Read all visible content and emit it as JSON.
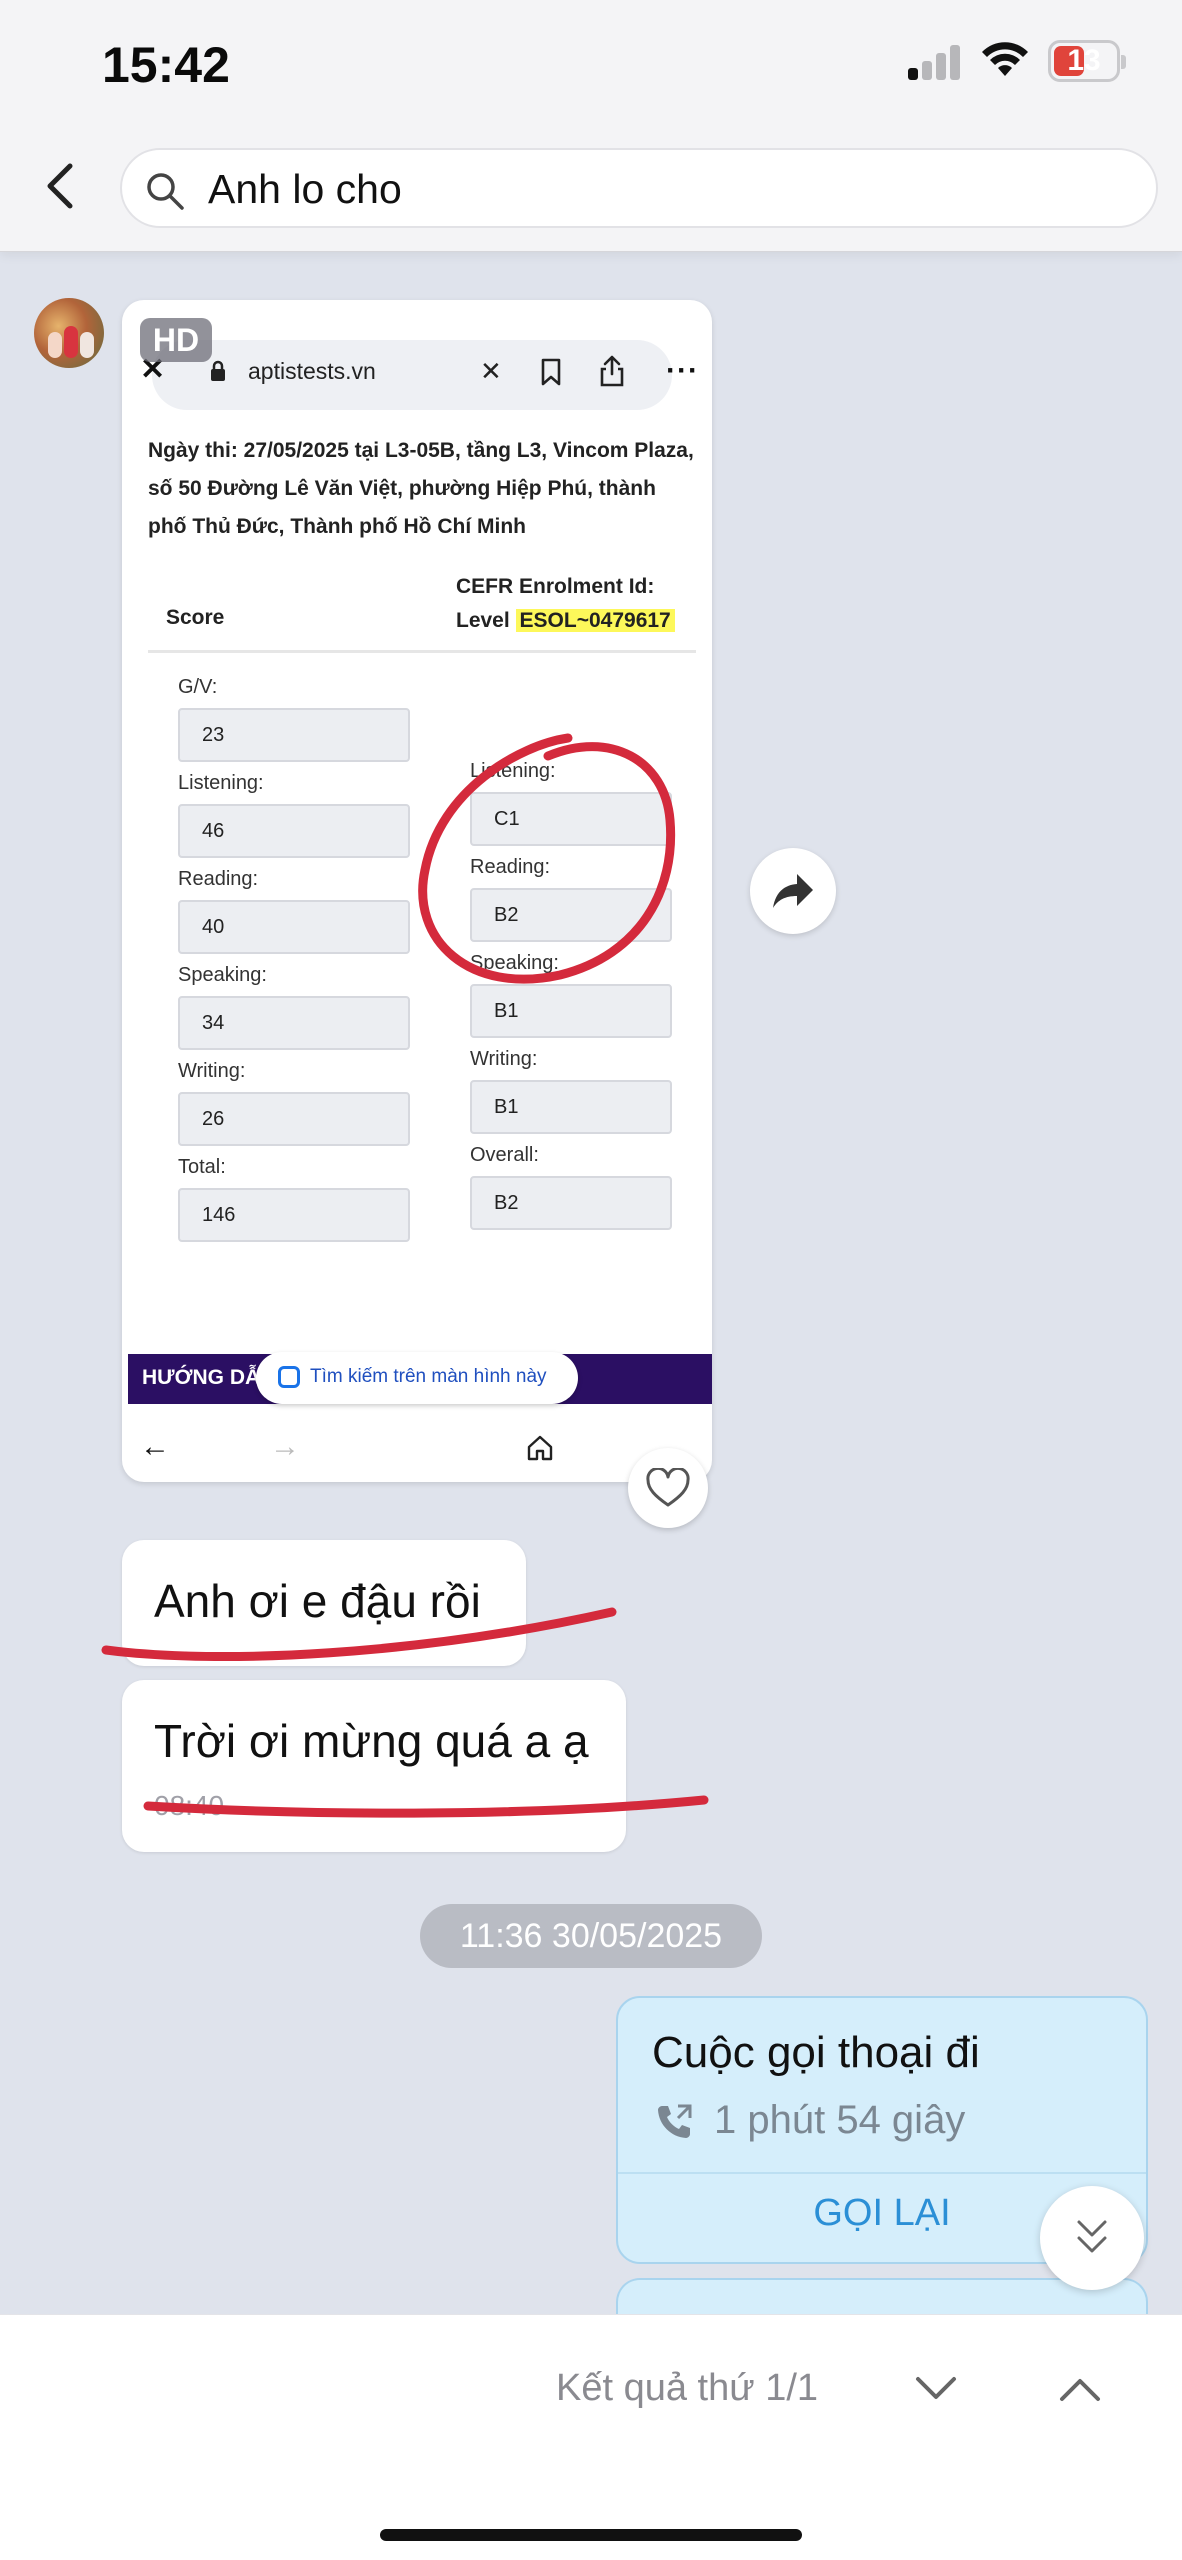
{
  "status_bar": {
    "time": "15:42",
    "battery": "13"
  },
  "header": {
    "search_value": "Anh lo cho"
  },
  "inner_screenshot": {
    "url": "aptistests.vn",
    "exam_info": "Ngày thi: 27/05/2025 tại L3-05B, tầng L3, Vincom Plaza, số 50 Đường Lê Văn Việt, phường Hiệp Phú, thành phố Thủ Đức, Thành phố Hồ Chí Minh",
    "score_header": "Score",
    "cefr_header_1": "CEFR",
    "cefr_header_2": "Level",
    "enrolment_label": "Enrolment Id:",
    "enrolment_id": "ESOL~0479617",
    "scores": [
      {
        "label": "G/V:",
        "value": "23"
      },
      {
        "label": "Listening:",
        "value": "46"
      },
      {
        "label": "Reading:",
        "value": "40"
      },
      {
        "label": "Speaking:",
        "value": "34"
      },
      {
        "label": "Writing:",
        "value": "26"
      },
      {
        "label": "Total:",
        "value": "146"
      }
    ],
    "levels": [
      {
        "label": "Listening:",
        "value": "C1"
      },
      {
        "label": "Reading:",
        "value": "B2"
      },
      {
        "label": "Speaking:",
        "value": "B1"
      },
      {
        "label": "Writing:",
        "value": "B1"
      },
      {
        "label": "Overall:",
        "value": "B2"
      }
    ],
    "banner_text": "HƯỚNG DẪ",
    "lens_chip": "Tìm kiếm trên màn hình này"
  },
  "image_badge": "HD",
  "messages": [
    {
      "text": "Anh ơi e đậu rồi"
    },
    {
      "text": "Trời ơi mừng quá a ạ",
      "time": "08:40"
    }
  ],
  "date_separator": "11:36 30/05/2025",
  "call_card": {
    "title": "Cuộc gọi thoại đi",
    "duration": "1 phút 54 giây",
    "action": "GỌI LẠI"
  },
  "search_nav": {
    "result_text": "Kết quả thứ 1/1"
  },
  "colors": {
    "annotation_red": "#d42a3c",
    "call_bg": "#d5eefb",
    "callback_blue": "#2b8fd6"
  }
}
